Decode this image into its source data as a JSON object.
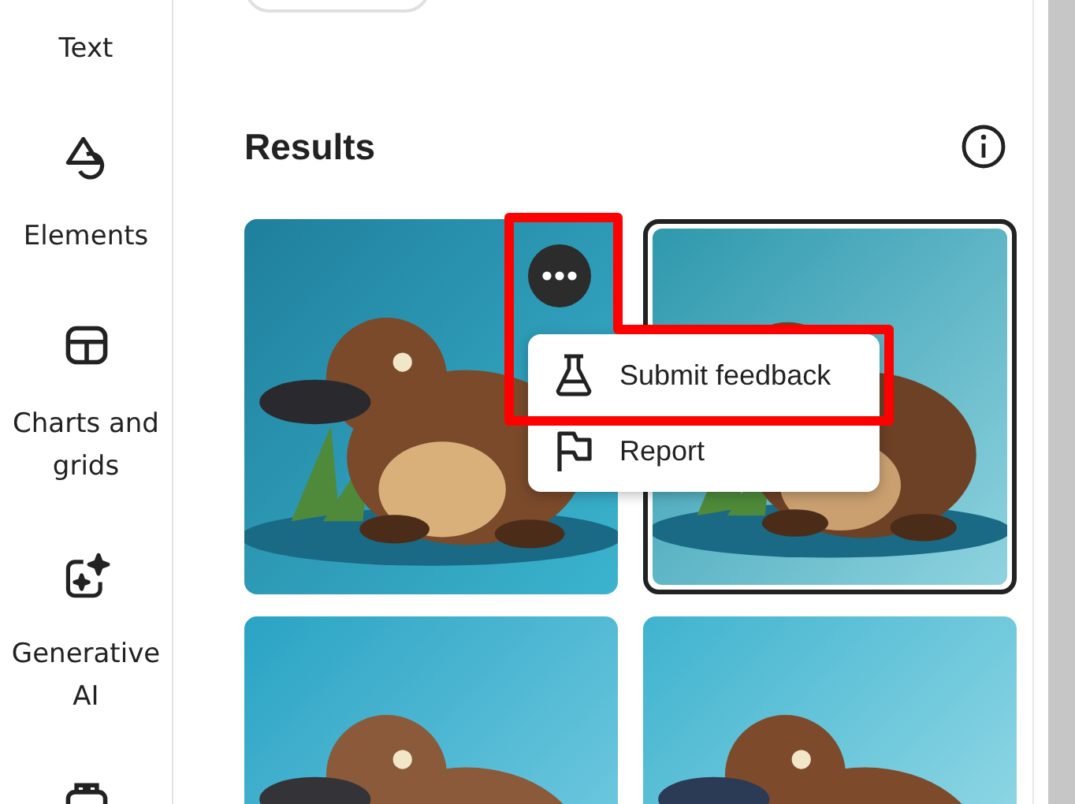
{
  "sidebar": {
    "items": [
      {
        "label": "Text"
      },
      {
        "label": "Elements"
      },
      {
        "label": "Charts and grids"
      },
      {
        "label": "Generative AI"
      }
    ]
  },
  "results": {
    "title": "Results",
    "images": [
      {
        "kind": "picture",
        "selected": false
      },
      {
        "kind": "picture",
        "selected": true
      },
      {
        "kind": "picture",
        "selected": false
      },
      {
        "kind": "picture",
        "selected": false
      }
    ]
  },
  "menu": {
    "items": [
      {
        "label": "Submit feedback"
      },
      {
        "label": "Report"
      }
    ]
  }
}
